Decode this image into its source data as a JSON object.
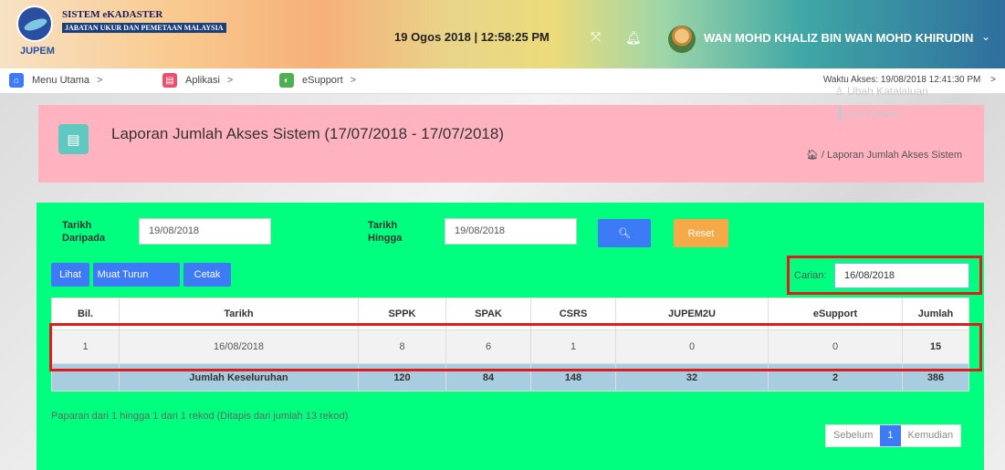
{
  "header": {
    "logo_text": "JUPEM",
    "system_title": "SISTEM eKADASTER",
    "system_subtitle": "JABATAN UKUR DAN PEMETAAN MALAYSIA",
    "datetime": "19 Ogos 2018 | 12:58:25 PM",
    "username": "WAN MOHD KHALIZ BIN WAN MOHD KHIRUDIN"
  },
  "nav": {
    "items": [
      {
        "label": "Menu Utama",
        "icon": "home-icon",
        "color": "#3d7af5"
      },
      {
        "label": "Aplikasi",
        "icon": "app-icon",
        "color": "#e94f6e"
      },
      {
        "label": "eSupport",
        "icon": "support-icon",
        "color": "#4caf50"
      }
    ],
    "access_time": "Waktu Akses: 19/08/2018 12:41:30 PM"
  },
  "user_menu": {
    "change_password": "Ubah Katalaluan",
    "logout": "Log Keluar"
  },
  "page": {
    "title": "Laporan Jumlah Akses Sistem (17/07/2018 - 17/07/2018)",
    "breadcrumb": "Laporan Jumlah Akses Sistem"
  },
  "filter": {
    "from_label_1": "Tarikh",
    "from_label_2": "Daripada",
    "from_value": "19/08/2018",
    "to_label_1": "Tarikh",
    "to_label_2": "Hingga",
    "to_value": "19/08/2018",
    "reset_label": "Reset"
  },
  "actions": {
    "view": "Lihat",
    "download": "Muat Turun",
    "print": "Cetak"
  },
  "search": {
    "label": "Carian:",
    "value": "16/08/2018"
  },
  "table": {
    "headers": [
      "Bil.",
      "Tarikh",
      "SPPK",
      "SPAK",
      "CSRS",
      "JUPEM2U",
      "eSupport",
      "Jumlah"
    ],
    "rows": [
      [
        "1",
        "16/08/2018",
        "8",
        "6",
        "1",
        "0",
        "0",
        "15"
      ]
    ],
    "total": [
      "",
      "Jumlah Keseluruhan",
      "120",
      "84",
      "148",
      "32",
      "2",
      "386"
    ]
  },
  "footer": {
    "info": "Paparan dari 1 hingga 1 dari 1 rekod (Ditapis dari jumlah 13 rekod)",
    "prev": "Sebelum",
    "page": "1",
    "next": "Kemudian"
  }
}
